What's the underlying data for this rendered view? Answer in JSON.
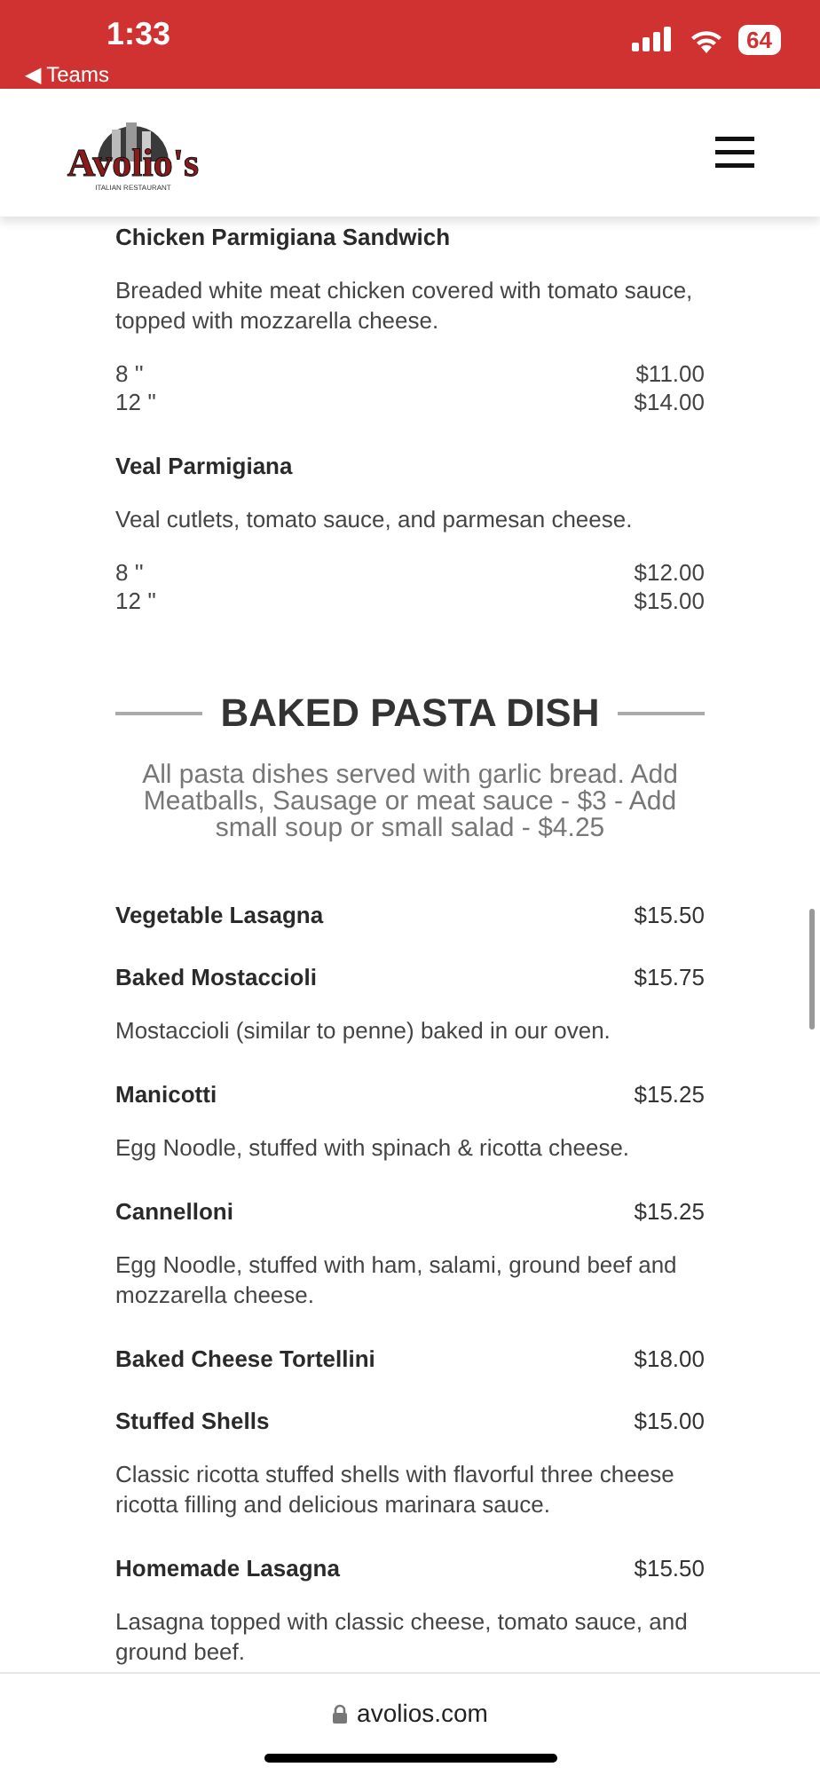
{
  "status_bar": {
    "time": "1:33",
    "back_label": "◀ Teams",
    "battery": "64"
  },
  "header": {
    "logo_name": "Avolio's",
    "logo_tagline": "ITALIAN RESTAURANT"
  },
  "menu": [
    {
      "kind": "item",
      "name": "Chicken Parmigiana Sandwich",
      "description": "Breaded white meat chicken covered with tomato sauce, topped with mozzarella cheese.",
      "sizes": [
        {
          "size": "8 ''",
          "price": "$11.00"
        },
        {
          "size": "12 ''",
          "price": "$14.00"
        }
      ]
    },
    {
      "kind": "item",
      "name": "Veal Parmigiana",
      "description": "Veal cutlets, tomato sauce, and parmesan cheese.",
      "sizes": [
        {
          "size": "8 ''",
          "price": "$12.00"
        },
        {
          "size": "12 ''",
          "price": "$15.00"
        }
      ]
    },
    {
      "kind": "heading",
      "title": "BAKED PASTA DISH",
      "note": "All pasta dishes served with garlic bread. Add Meatballs, Sausage or meat sauce - $3 - Add small soup or small salad - $4.25"
    },
    {
      "kind": "item",
      "name": "Vegetable Lasagna",
      "price": "$15.50"
    },
    {
      "kind": "item",
      "name": "Baked Mostaccioli",
      "price": "$15.75",
      "description": "Mostaccioli (similar to penne) baked in our oven."
    },
    {
      "kind": "item",
      "name": "Manicotti",
      "price": "$15.25",
      "description": "Egg Noodle, stuffed with spinach & ricotta cheese."
    },
    {
      "kind": "item",
      "name": "Cannelloni",
      "price": "$15.25",
      "description": "Egg Noodle, stuffed with ham, salami, ground beef and mozzarella cheese."
    },
    {
      "kind": "item",
      "name": "Baked Cheese Tortellini",
      "price": "$18.00"
    },
    {
      "kind": "item",
      "name": "Stuffed Shells",
      "price": "$15.00",
      "description": "Classic ricotta stuffed shells with flavorful three cheese ricotta filling and delicious marinara sauce."
    },
    {
      "kind": "item",
      "name": "Homemade Lasagna",
      "price": "$15.50",
      "description": "Lasagna topped with classic cheese, tomato sauce, and ground beef."
    }
  ],
  "address_bar": {
    "url": "avolios.com"
  }
}
